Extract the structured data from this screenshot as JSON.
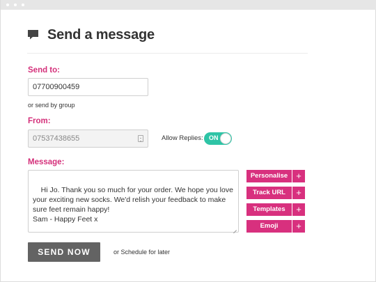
{
  "page": {
    "title": "Send a message",
    "chat_icon": "chat-bubble-icon"
  },
  "to": {
    "label": "Send to:",
    "value": "07700900459",
    "group_link": "or send by group"
  },
  "from": {
    "label": "From:",
    "value": "07537438655",
    "icon": "phone-icon"
  },
  "replies": {
    "label": "Allow Replies:",
    "toggle_text": "ON",
    "enabled": true,
    "color": "#2ec4a6"
  },
  "message": {
    "label": "Message:",
    "text": "Hi Jo. Thank you so much for your order. We hope you love\nyour exciting new socks. We'd relish your feedback to make\nsure feet remain happy!\nSam - Happy Feet x"
  },
  "side_buttons": [
    {
      "label": "Personalise",
      "icon": "+"
    },
    {
      "label": "Track URL",
      "icon": "+"
    },
    {
      "label": "Templates",
      "icon": "+"
    },
    {
      "label": "Emoji",
      "icon": "+"
    }
  ],
  "actions": {
    "send_label": "SEND NOW",
    "schedule_text": "or Schedule for later"
  },
  "colors": {
    "accent": "#d8307e",
    "label": "#d4307a",
    "send_button": "#636363"
  }
}
